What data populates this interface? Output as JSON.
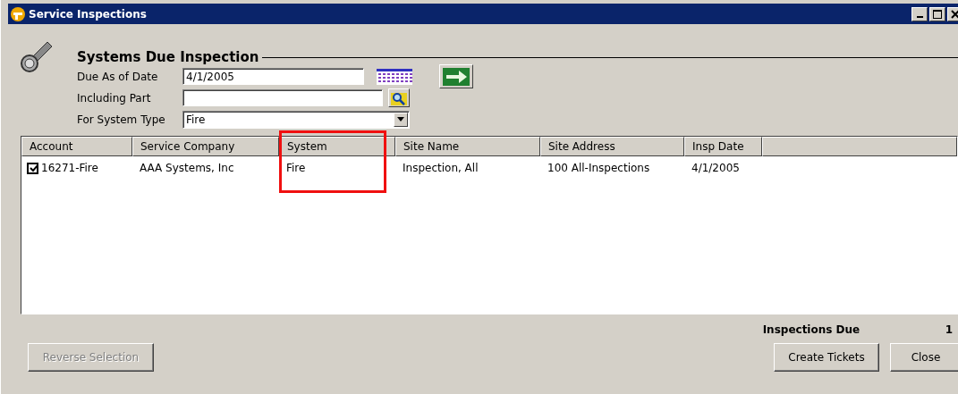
{
  "window": {
    "title": "Service Inspections"
  },
  "section": {
    "title": "Systems Due Inspection"
  },
  "filters": [
    {
      "kind": "date",
      "label": "Due As of Date",
      "value": "4/1/2005"
    },
    {
      "kind": "lookup",
      "label": "Including Part"
    },
    {
      "kind": "dropdown",
      "label": "For System Type",
      "value": "Fire"
    }
  ],
  "table": {
    "columns": [
      {
        "label": "Account",
        "highlighted": false
      },
      {
        "label": "Service Company",
        "highlighted": false
      },
      {
        "label": "System",
        "highlighted": true
      },
      {
        "label": "Site Name",
        "highlighted": false
      },
      {
        "label": "Site Address",
        "highlighted": false
      },
      {
        "label": "Insp Date",
        "highlighted": false
      }
    ],
    "rows": [
      {
        "checked": true,
        "cells": [
          "16271-Fire",
          "AAA Systems, Inc",
          "Fire",
          "Inspection, All",
          "100 All-Inspections",
          "4/1/2005"
        ]
      }
    ]
  },
  "summary": {
    "label": "Inspections Due",
    "value": "1"
  },
  "buttons": [
    {
      "label": "Reverse Selection",
      "disabled": true
    },
    {
      "label": "Create Tickets",
      "disabled": false
    },
    {
      "label": "Close",
      "disabled": false
    }
  ]
}
